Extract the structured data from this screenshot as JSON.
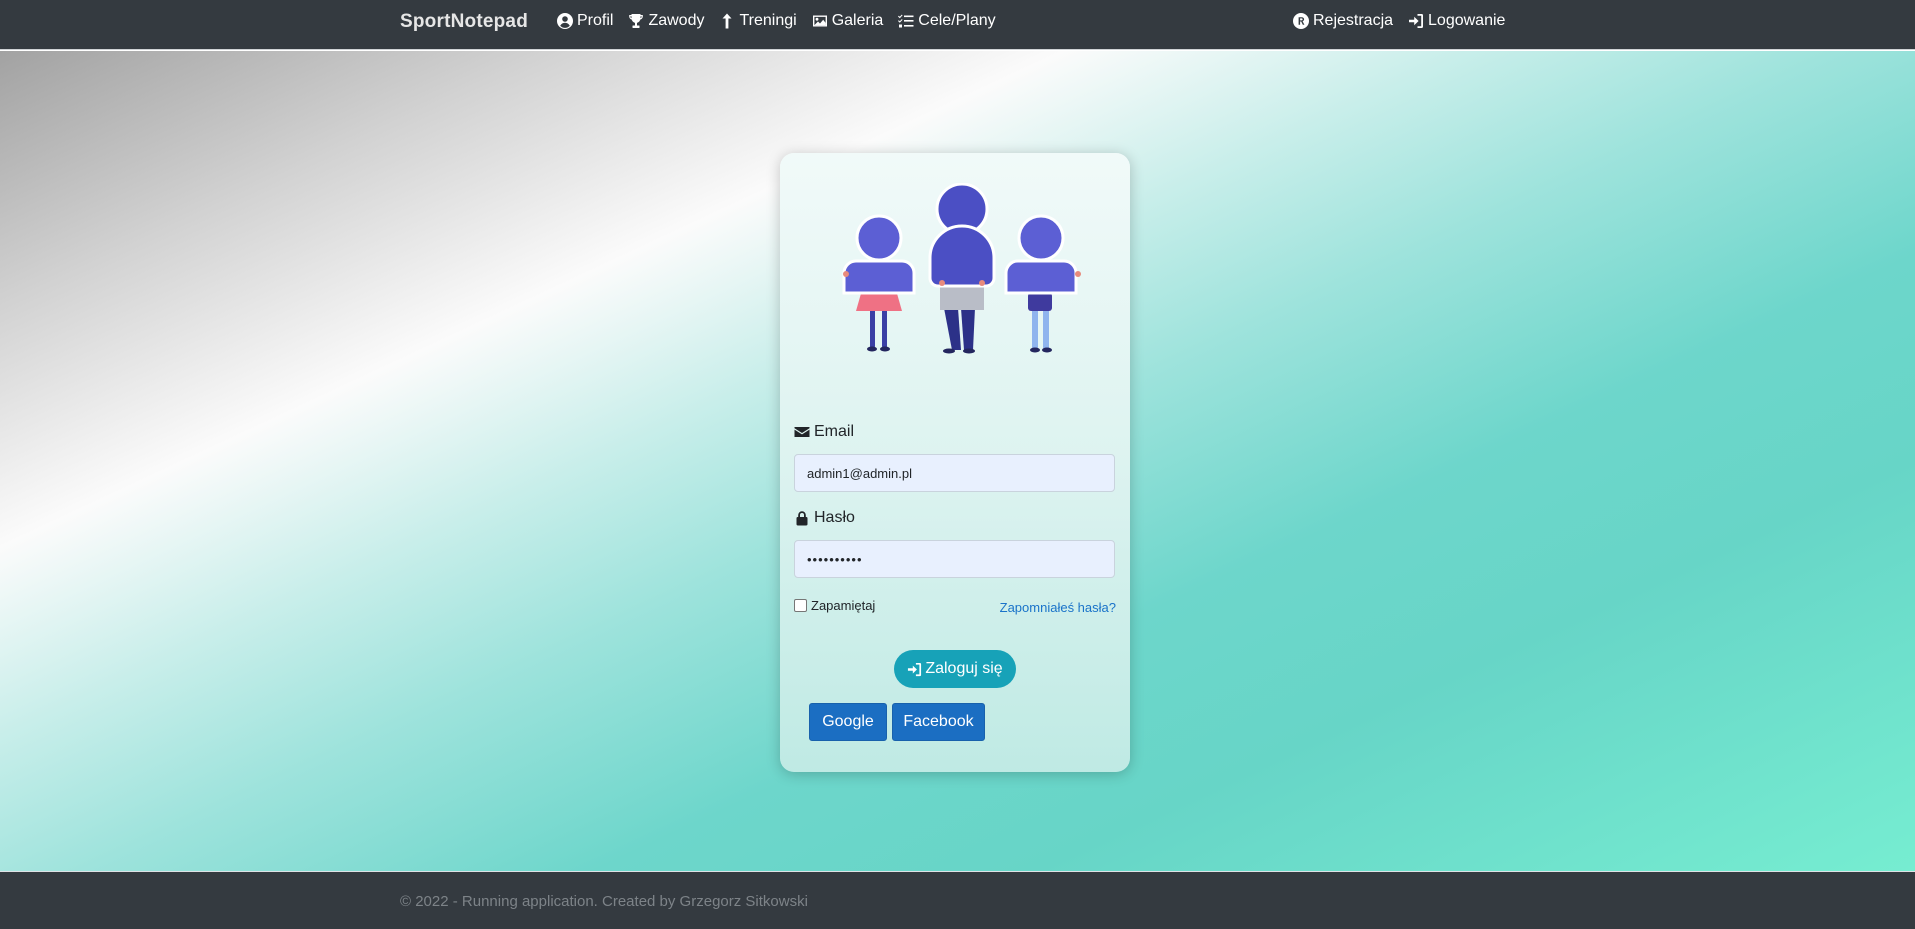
{
  "navbar": {
    "brand": "SportNotepad",
    "left_links": [
      {
        "label": "Profil",
        "icon": "user-circle-icon"
      },
      {
        "label": "Zawody",
        "icon": "trophy-icon"
      },
      {
        "label": "Treningi",
        "icon": "arrow-up-icon"
      },
      {
        "label": "Galeria",
        "icon": "image-icon"
      },
      {
        "label": "Cele/Plany",
        "icon": "checklist-icon"
      }
    ],
    "right_links": [
      {
        "label": "Rejestracja",
        "icon": "registered-icon"
      },
      {
        "label": "Logowanie",
        "icon": "sign-in-icon"
      }
    ]
  },
  "login": {
    "email_label": "Email",
    "email_value": "admin1@admin.pl",
    "password_label": "Hasło",
    "password_value": "••••••••••",
    "remember_label": "Zapamiętaj",
    "remember_checked": false,
    "forgot_label": "Zapomniałeś hasła?",
    "submit_label": "Zaloguj się",
    "google_label": "Google",
    "facebook_label": "Facebook"
  },
  "footer": {
    "text": "© 2022 - Running application. Created by Grzegorz Sitkowski"
  },
  "colors": {
    "navbar_bg": "#343a40",
    "accent_button": "#17a2b8",
    "social_button": "#1b6ec2",
    "link": "#1a73c9",
    "illustration_primary": "#4b4fc4"
  }
}
